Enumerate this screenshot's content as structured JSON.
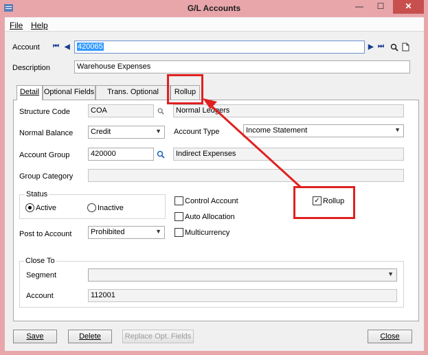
{
  "window": {
    "title": "G/L Accounts",
    "minimize": "—",
    "maximize": "☐",
    "close": "✕"
  },
  "menu": {
    "file": "File",
    "help": "Help"
  },
  "account": {
    "label": "Account",
    "value": "420065",
    "first": "⏮",
    "prev": "◀",
    "next": "▶",
    "last": "⏭",
    "search": "🔍",
    "new": "🗋"
  },
  "description": {
    "label": "Description",
    "value": "Warehouse Expenses"
  },
  "tabs": [
    {
      "label": "Detail"
    },
    {
      "label": "Optional Fields"
    },
    {
      "label": "Trans. Optional Fields"
    },
    {
      "label": "Rollup"
    }
  ],
  "detail": {
    "structure_code": {
      "label": "Structure Code",
      "value": "COA",
      "desc": "Normal Ledgers"
    },
    "normal_balance": {
      "label": "Normal Balance",
      "value": "Credit"
    },
    "account_type": {
      "label": "Account Type",
      "value": "Income Statement"
    },
    "account_group": {
      "label": "Account Group",
      "value": "420000",
      "desc": "Indirect Expenses"
    },
    "group_category": {
      "label": "Group Category",
      "value": ""
    },
    "status": {
      "label": "Status",
      "active": "Active",
      "inactive": "Inactive"
    },
    "post_to_account": {
      "label": "Post to Account",
      "value": "Prohibited"
    },
    "control_account": {
      "label": "Control Account"
    },
    "auto_allocation": {
      "label": "Auto Allocation"
    },
    "multicurrency": {
      "label": "Multicurrency"
    },
    "rollup": {
      "label": "Rollup",
      "check": "✓"
    },
    "close_to": {
      "label": "Close To",
      "segment_label": "Segment",
      "segment_value": "",
      "account_label": "Account",
      "account_value": "112001"
    }
  },
  "buttons": {
    "save": "Save",
    "delete": "Delete",
    "replace": "Replace Opt. Fields",
    "close": "Close"
  },
  "colors": {
    "annotation": "#e02020",
    "titlebar": "#e8a6ab",
    "selection": "#3399ff"
  }
}
